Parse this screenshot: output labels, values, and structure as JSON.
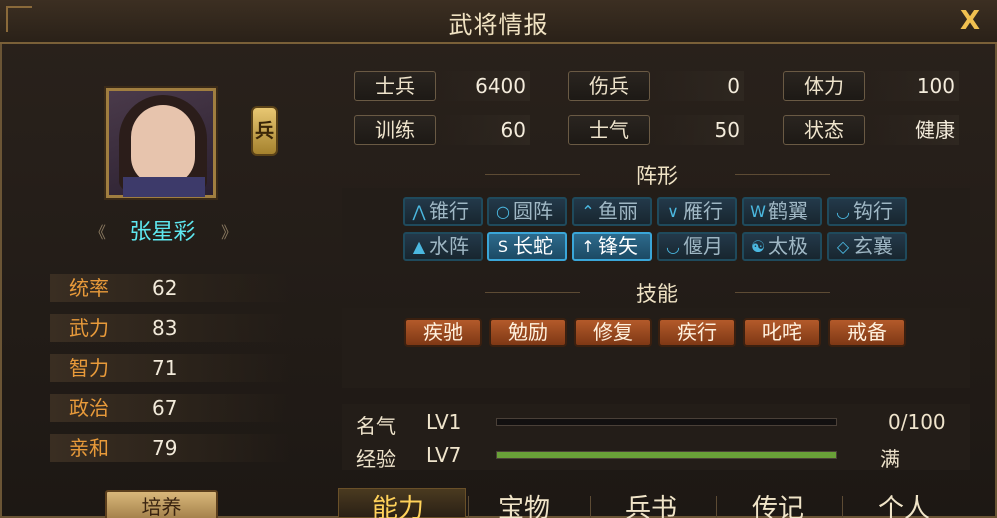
{
  "window": {
    "title": "武将情报",
    "close_label": "X"
  },
  "general": {
    "name": "张星彩",
    "unit_type": "兵",
    "attributes": [
      {
        "label": "统率",
        "value": "62"
      },
      {
        "label": "武力",
        "value": "83"
      },
      {
        "label": "智力",
        "value": "71"
      },
      {
        "label": "政治",
        "value": "67"
      },
      {
        "label": "亲和",
        "value": "79"
      }
    ],
    "cultivate_label": "培养"
  },
  "stats": [
    {
      "label": "士兵",
      "value": "6400"
    },
    {
      "label": "伤兵",
      "value": "0"
    },
    {
      "label": "体力",
      "value": "100"
    },
    {
      "label": "训练",
      "value": "60"
    },
    {
      "label": "士气",
      "value": "50"
    },
    {
      "label": "状态",
      "value": "健康"
    }
  ],
  "formation": {
    "title": "阵形",
    "items": [
      {
        "icon": "arrow-up-icon",
        "glyph": "⋀",
        "label": "锥行",
        "active": false
      },
      {
        "icon": "circle-icon",
        "glyph": "○",
        "label": "圆阵",
        "active": false
      },
      {
        "icon": "fish-scale-icon",
        "glyph": "⌃",
        "label": "鱼丽",
        "active": false
      },
      {
        "icon": "v-icon",
        "glyph": "∨",
        "label": "雁行",
        "active": false
      },
      {
        "icon": "wing-icon",
        "glyph": "W",
        "label": "鹤翼",
        "active": false
      },
      {
        "icon": "hook-icon",
        "glyph": "◡",
        "label": "钩行",
        "active": false
      },
      {
        "icon": "mountain-icon",
        "glyph": "▲",
        "label": "水阵",
        "active": false
      },
      {
        "icon": "snake-icon",
        "glyph": "S",
        "label": "长蛇",
        "active": true
      },
      {
        "icon": "arrow-icon",
        "glyph": "↑",
        "label": "锋矢",
        "active": true
      },
      {
        "icon": "moon-icon",
        "glyph": "◡",
        "label": "偃月",
        "active": false
      },
      {
        "icon": "taiji-icon",
        "glyph": "☯",
        "label": "太极",
        "active": false
      },
      {
        "icon": "diamond-icon",
        "glyph": "◇",
        "label": "玄襄",
        "active": false
      }
    ]
  },
  "skills": {
    "title": "技能",
    "items": [
      "疾驰",
      "勉励",
      "修复",
      "疾行",
      "叱咤",
      "戒备"
    ]
  },
  "progress": [
    {
      "label": "名气",
      "level": "LV1",
      "fraction": 0,
      "value_text": "0/100"
    },
    {
      "label": "经验",
      "level": "LV7",
      "fraction": 1,
      "value_text": "满"
    }
  ],
  "tabs": [
    "能力",
    "宝物",
    "兵书",
    "传记",
    "个人"
  ],
  "colors": {
    "accent": "#ffd25a",
    "name": "#5ee8f0",
    "attr_label": "#e89a3a",
    "bar_fill": "#69a038"
  }
}
